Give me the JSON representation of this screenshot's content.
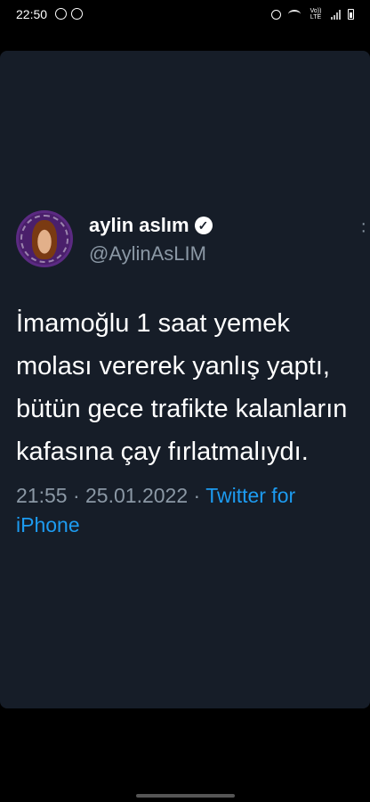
{
  "status_bar": {
    "time": "22:50",
    "volte_label": "Vo))\nLTE"
  },
  "tweet": {
    "display_name": "aylin aslım",
    "username": "@AylinAsLIM",
    "text": "İmamoğlu 1 saat yemek molası vererek yanlış yaptı, bütün gece trafikte kalanların kafasına çay fırlatmalıydı.",
    "time": "21:55",
    "separator": "·",
    "date": "25.01.2022",
    "source": "Twitter for iPhone",
    "verified": true
  },
  "colors": {
    "background": "#000000",
    "card": "#161d28",
    "muted_text": "#8b98a5",
    "link": "#1d9bf0"
  },
  "icons": [
    "whatsapp-icon",
    "alarm-icon",
    "wifi-icon",
    "signal-icon",
    "battery-icon",
    "verified-icon",
    "more-icon"
  ]
}
